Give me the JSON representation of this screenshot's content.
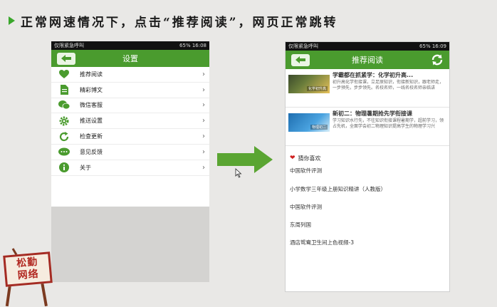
{
  "slide": {
    "heading": "正常网速情况下，点击“推荐阅读”，网页正常跳转"
  },
  "colors": {
    "brand_green": "#4a9b2e",
    "arrow_green": "#5aa532",
    "heart_red": "#d02020"
  },
  "phone_settings": {
    "status": {
      "left": "仅限紧急呼叫",
      "right": "65% 16:08"
    },
    "title": "设置",
    "items": [
      {
        "label": "推荐阅读",
        "icon": "heart-icon"
      },
      {
        "label": "精彩博文",
        "icon": "document-icon"
      },
      {
        "label": "微信客服",
        "icon": "wechat-icon"
      },
      {
        "label": "推送设置",
        "icon": "gear-icon"
      },
      {
        "label": "检查更新",
        "icon": "refresh-icon"
      },
      {
        "label": "意见反馈",
        "icon": "chat-bubble-icon"
      },
      {
        "label": "关于",
        "icon": "info-icon"
      }
    ]
  },
  "phone_reading": {
    "status": {
      "left": "仅限紧急呼叫",
      "right": "65% 16:09"
    },
    "title": "推荐阅读",
    "articles": [
      {
        "title": "学霸都在抓紧学：化学初升高...",
        "desc": "初升高化学衔接课，立足原知识，衔接新知识，跟老师走，一步预先，步步领先。名校名师，一线名校名师亲临讲",
        "thumb_text": "化学初升高"
      },
      {
        "title": "新初二：物理暑期抢先学衔接课",
        "desc": "学习知识水行先，不往知识衔接课程暑期学，超前学习，领占先机，全面学会初二物理知识提高学生的物理学习兴",
        "thumb_text": "物理初二"
      }
    ],
    "guess_header": "猜你喜欢",
    "guess_items": [
      "中国软件评测",
      "小学数学三年级上册知识精讲（人教版）",
      "中国软件评测",
      "东周列国",
      "酒店鸳鸯卫生间上色视频-3"
    ]
  },
  "sign": {
    "line1": "松勤",
    "line2": "网络"
  }
}
